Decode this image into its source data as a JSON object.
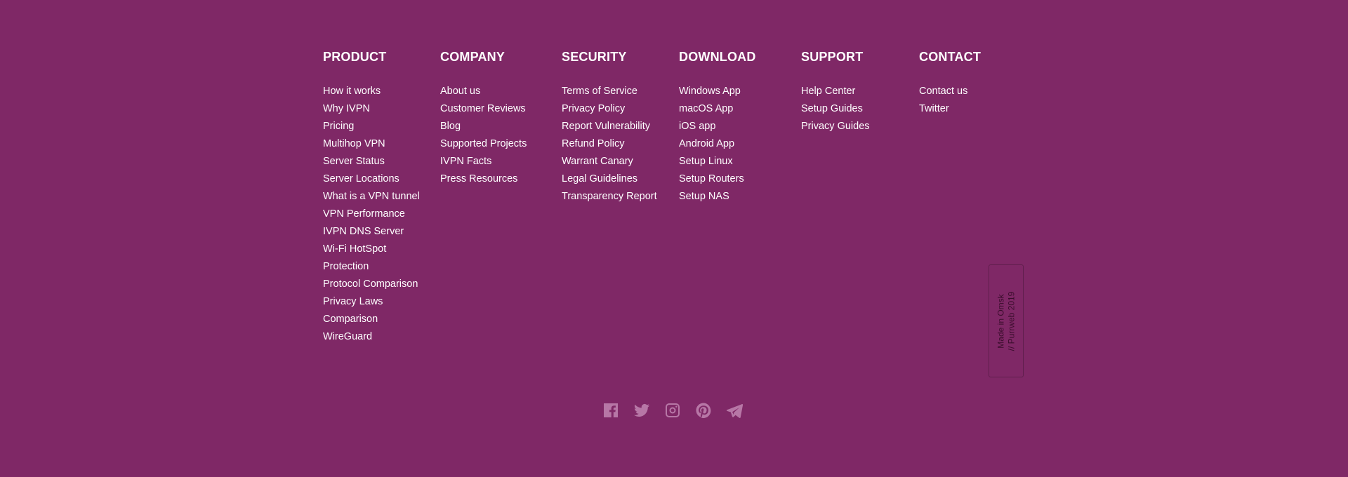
{
  "columns": {
    "product": {
      "title": "PRODUCT",
      "links": [
        "How it works",
        "Why IVPN",
        "Pricing",
        "Multihop VPN",
        "Server Status",
        "Server Locations",
        "What is a VPN tunnel",
        "VPN Performance",
        "IVPN DNS Server",
        "Wi-Fi HotSpot",
        "Protection",
        "Protocol Comparison",
        "Privacy Laws",
        "Comparison",
        "WireGuard"
      ]
    },
    "company": {
      "title": "COMPANY",
      "links": [
        "About us",
        "Customer Reviews",
        "Blog",
        "Supported Projects",
        "IVPN Facts",
        "Press Resources"
      ]
    },
    "security": {
      "title": "SECURITY",
      "links": [
        "Terms of Service",
        "Privacy Policy",
        "Report Vulnerability",
        "Refund Policy",
        "Warrant Canary",
        "Legal Guidelines",
        "Transparency Report"
      ]
    },
    "download": {
      "title": "DOWNLOAD",
      "links": [
        "Windows App",
        "macOS App",
        "iOS app",
        "Android App",
        "Setup Linux",
        "Setup Routers",
        "Setup NAS"
      ]
    },
    "support": {
      "title": "SUPPORT",
      "links": [
        "Help Center",
        "Setup Guides",
        "Privacy Guides"
      ]
    },
    "contact": {
      "title": "CONTACT",
      "links": [
        "Contact us",
        "Twitter"
      ]
    }
  },
  "made_in": {
    "line1": "Made in Omsk",
    "line2": "// Purrweb 2019"
  },
  "social": {
    "icons": [
      "facebook-icon",
      "twitter-icon",
      "instagram-icon",
      "pinterest-icon",
      "telegram-icon"
    ],
    "icon_color": "#b777a6"
  },
  "colors": {
    "background": "#7f2866",
    "text": "#ffffff"
  }
}
